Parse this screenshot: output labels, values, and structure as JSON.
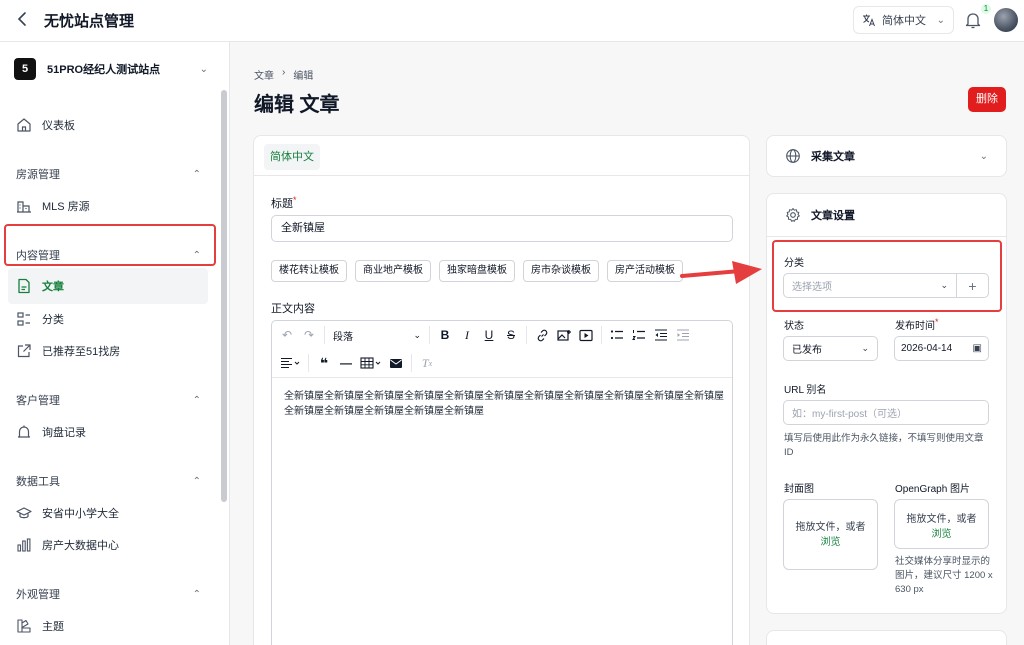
{
  "header": {
    "title": "无忧站点管理",
    "language": "简体中文",
    "notification_count": "1"
  },
  "sidebar": {
    "site_badge": "5",
    "site_name": "51PRO经纪人测试站点",
    "dashboard": "仪表板",
    "groups": {
      "listings": "房源管理",
      "content": "内容管理",
      "customers": "客户管理",
      "data_tools": "数据工具",
      "appearance": "外观管理"
    },
    "items": {
      "mls": "MLS 房源",
      "articles": "文章",
      "categories": "分类",
      "recommended": "已推荐至51找房",
      "inquiries": "询盘记录",
      "schools": "安省中小学大全",
      "bigdata": "房产大数据中心",
      "theme": "主题"
    }
  },
  "main": {
    "breadcrumb": [
      "文章",
      "编辑"
    ],
    "title": "编辑 文章",
    "delete_label": "删除",
    "editor": {
      "lang_tab": "简体中文",
      "title_label": "标题",
      "title_value": "全新镇屋",
      "templates": [
        "楼花转让模板",
        "商业地产模板",
        "独家暗盘模板",
        "房市杂谈模板",
        "房产活动模板"
      ],
      "body_label": "正文内容",
      "paragraph_select": "段落",
      "body_text": "全新镇屋全新镇屋全新镇屋全新镇屋全新镇屋全新镇屋全新镇屋全新镇屋全新镇屋全新镇屋全新镇屋全新镇屋全新镇屋全新镇屋全新镇屋全新镇屋"
    }
  },
  "panels": {
    "collect": {
      "title": "采集文章"
    },
    "settings": {
      "title": "文章设置",
      "category_label": "分类",
      "category_placeholder": "选择选项",
      "status_label": "状态",
      "status_value": "已发布",
      "publish_label": "发布时间",
      "publish_value": "2026-04-14",
      "slug_label": "URL 别名",
      "slug_placeholder": "如：my-first-post（可选）",
      "slug_help": "填写后使用此作为永久链接，不填写则使用文章 ID",
      "cover_label": "封面图",
      "og_label": "OpenGraph 图片",
      "drop_text": "拖放文件，或者",
      "drop_link": "浏览",
      "og_help": "社交媒体分享时显示的图片，建议尺寸 1200 x 630 px"
    }
  },
  "colors": {
    "accent": "#15803d",
    "danger": "#e11d1d",
    "annotation": "#e53e3e"
  }
}
